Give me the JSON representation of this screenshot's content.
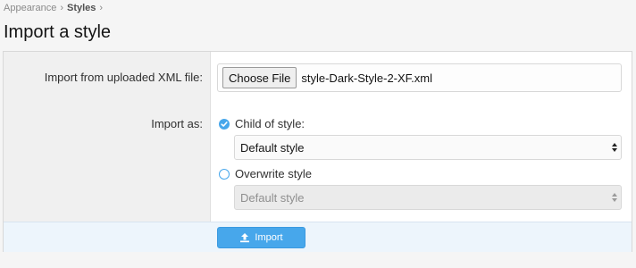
{
  "breadcrumb": {
    "items": [
      "Appearance",
      "Styles"
    ]
  },
  "page": {
    "title": "Import a style"
  },
  "form": {
    "import_file_label": "Import from uploaded XML file:",
    "choose_file_label": "Choose File",
    "file_name": "style-Dark-Style-2-XF.xml",
    "import_as_label": "Import as:",
    "options": [
      {
        "label": "Child of style:",
        "checked": true,
        "select_value": "Default style",
        "disabled": false
      },
      {
        "label": "Overwrite style",
        "checked": false,
        "select_value": "Default style",
        "disabled": true
      }
    ],
    "submit_label": "Import"
  },
  "colors": {
    "accent": "#47a7eb",
    "footer_bg": "#edf5fc"
  },
  "icons": {
    "checked_radio": "check-icon",
    "submit": "upload-icon",
    "select_arrows": "select-arrows-icon"
  }
}
